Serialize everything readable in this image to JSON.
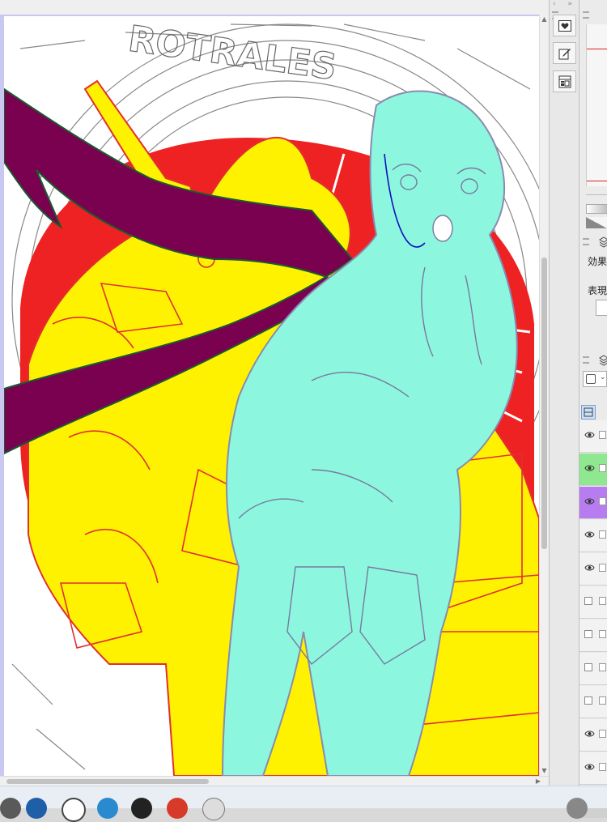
{
  "canvas": {
    "image_name": "illustration-canvas"
  },
  "panels": {
    "effect_label": "効果",
    "expression_label": "表現"
  },
  "toolbar": {
    "chevron": "»",
    "buttons": [
      {
        "name": "favorite-icon"
      },
      {
        "name": "edit-icon"
      },
      {
        "name": "layout-icon"
      }
    ]
  },
  "layers": [
    {
      "visible": true,
      "color": "#f2f2f2"
    },
    {
      "visible": true,
      "color": "#8fe88f"
    },
    {
      "visible": true,
      "color": "#b77cf0"
    },
    {
      "visible": true,
      "color": "#f2f2f2"
    },
    {
      "visible": true,
      "color": "#f2f2f2"
    },
    {
      "visible": false,
      "color": "#f2f2f2"
    },
    {
      "visible": false,
      "color": "#f2f2f2"
    },
    {
      "visible": false,
      "color": "#f2f2f2"
    },
    {
      "visible": false,
      "color": "#f2f2f2"
    },
    {
      "visible": true,
      "color": "#f2f2f2"
    },
    {
      "visible": true,
      "color": "#f2f2f2"
    },
    {
      "visible": true,
      "color": "#d0d0d0"
    }
  ],
  "colors": {
    "yellow_fill": "#fff200",
    "red_fill": "#ee2222",
    "cyan_fill": "#8cf7de",
    "purple_fill": "#7a0050",
    "accent_red": "#e02020"
  }
}
